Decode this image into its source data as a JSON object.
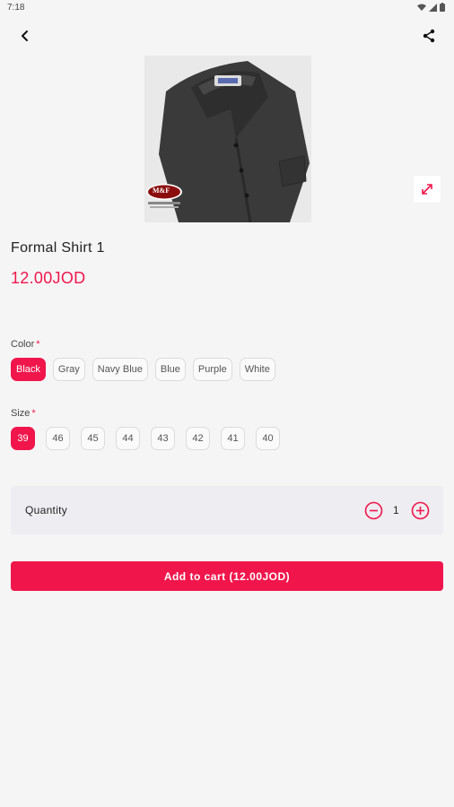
{
  "status_bar": {
    "time": "7:18"
  },
  "header": {
    "back_icon": "chevron-left-icon",
    "share_icon": "share-icon"
  },
  "product": {
    "name": "Formal Shirt 1",
    "price": "12.00JOD",
    "brand_logo": "M&F"
  },
  "color_option": {
    "label": "Color",
    "required_mark": "*",
    "values": [
      "Black",
      "Gray",
      "Navy Blue",
      "Blue",
      "Purple",
      "White"
    ],
    "selected": "Black"
  },
  "size_option": {
    "label": "Size",
    "required_mark": "*",
    "values": [
      "39",
      "46",
      "45",
      "44",
      "43",
      "42",
      "41",
      "40"
    ],
    "selected": "39"
  },
  "quantity": {
    "label": "Quantity",
    "value": "1"
  },
  "cart": {
    "button_label": "Add to cart (12.00JOD)"
  },
  "colors": {
    "accent": "#f0164b",
    "background": "#f5f5f6",
    "quantity_bg": "#eeedf1"
  }
}
